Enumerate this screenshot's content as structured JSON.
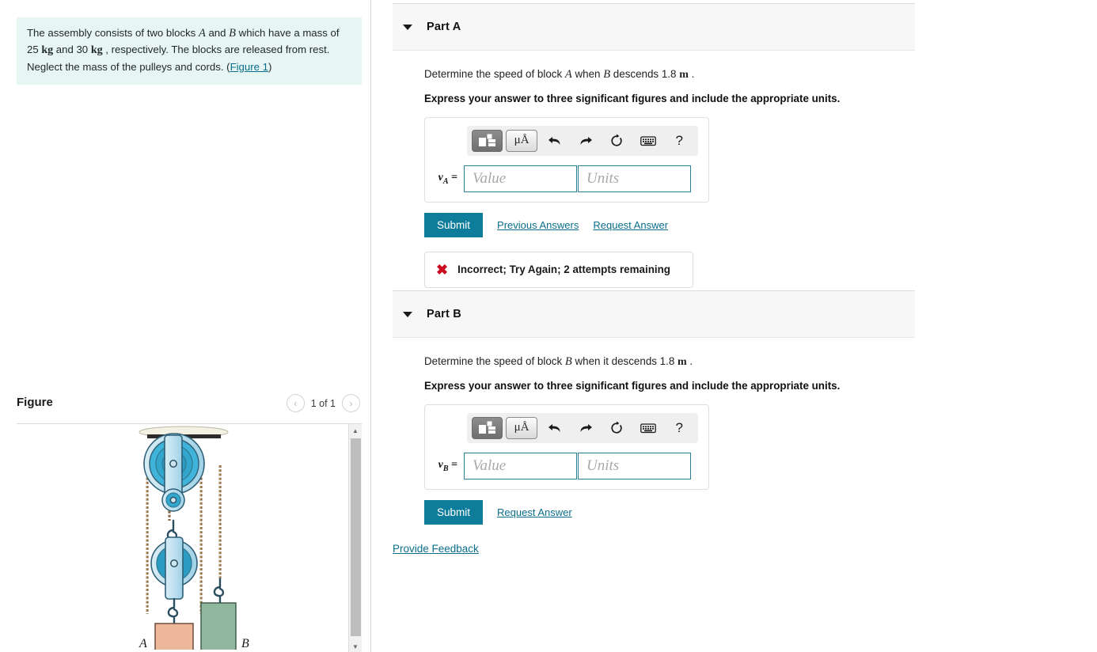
{
  "problem": {
    "text_1": "The assembly consists of two blocks ",
    "var_a": "A",
    "text_2": " and ",
    "var_b": "B",
    "text_3": " which have a mass of 25 ",
    "unit_kg_1": "kg",
    "text_4": " and 30 ",
    "unit_kg_2": "kg",
    "text_5": " , respectively. The blocks are released from rest. Neglect the mass of the pulleys and cords. (",
    "figure_link": "Figure 1",
    "text_6": ")"
  },
  "figure": {
    "title": "Figure",
    "counter": "1 of 1",
    "prev_icon": "‹",
    "next_icon": "›",
    "scroll_up_icon": "▲",
    "scroll_down_icon": "▼",
    "block_a_label": "A",
    "block_b_label": "B"
  },
  "toolbar": {
    "template_icon": "template-icon",
    "units_label": "μÅ",
    "undo_icon": "↶",
    "redo_icon": "↷",
    "reset_icon": "⟳",
    "keyboard_icon": "⌨",
    "help_icon": "?"
  },
  "parts": [
    {
      "label": "Part A",
      "question_pre": "Determine the speed of block ",
      "question_var1": "A",
      "question_mid": " when ",
      "question_var2": "B",
      "question_post": " descends 1.8 ",
      "question_unit": "m",
      "question_end": " .",
      "instruction": "Express your answer to three significant figures and include the appropriate units.",
      "answer_label": "v",
      "answer_sub": "A",
      "answer_eq": " =",
      "value_placeholder": "Value",
      "units_placeholder": "Units",
      "value": "",
      "units": "",
      "submit_label": "Submit",
      "previous_answers_label": "Previous Answers",
      "request_answer_label": "Request Answer",
      "feedback": "Incorrect; Try Again; 2 attempts remaining",
      "feedback_icon": "✖"
    },
    {
      "label": "Part B",
      "question_pre": "Determine the speed of block ",
      "question_var1": "B",
      "question_mid": " when it descends 1.8 ",
      "question_var2": "",
      "question_post": "",
      "question_unit": "m",
      "question_end": " .",
      "instruction": "Express your answer to three significant figures and include the appropriate units.",
      "answer_label": "v",
      "answer_sub": "B",
      "answer_eq": " =",
      "value_placeholder": "Value",
      "units_placeholder": "Units",
      "value": "",
      "units": "",
      "submit_label": "Submit",
      "previous_answers_label": "",
      "request_answer_label": "Request Answer",
      "feedback": "",
      "feedback_icon": ""
    }
  ],
  "footer": {
    "provide_feedback_label": "Provide Feedback"
  },
  "colors": {
    "accent_teal": "#0e7c9b",
    "link": "#0b6e8a",
    "info_bg": "#e7f5f4",
    "error_red": "#cc0a1e",
    "panel_bg": "#f7f7f7"
  }
}
